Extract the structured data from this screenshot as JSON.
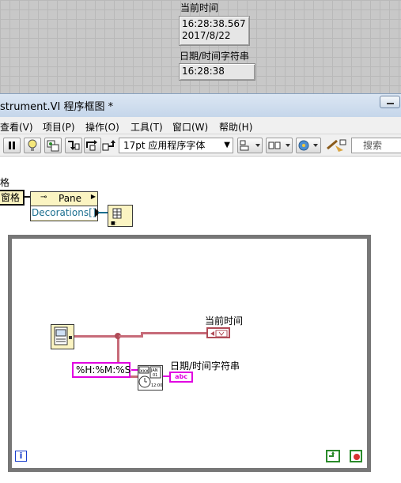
{
  "front_panel": {
    "current_time_label": "当前时间",
    "current_time_value_line1": "16:28:38.567",
    "current_time_value_line2": "2017/8/22",
    "datetime_string_label": "日期/时间字符串",
    "datetime_string_value": "16:28:38"
  },
  "window": {
    "title": "strument.VI 程序框图 *"
  },
  "menu": {
    "items": [
      "查看(V)",
      "项目(P)",
      "操作(O)",
      "工具(T)",
      "窗口(W)",
      "帮助(H)"
    ]
  },
  "toolbar": {
    "font_select": "17pt 应用程序字体",
    "search_placeholder": "搜索"
  },
  "diagram": {
    "side_label": "格",
    "pane_ref_label": "窗格",
    "property_node_title": "Pane",
    "property_node_item": "Decorations[]",
    "format_string": "%H:%M:%S",
    "indicator_current_time": "当前时间",
    "indicator_datetime_string": "日期/时间字符串",
    "string_terminal_text": "abc",
    "loop_iteration_terminal": "i"
  }
}
